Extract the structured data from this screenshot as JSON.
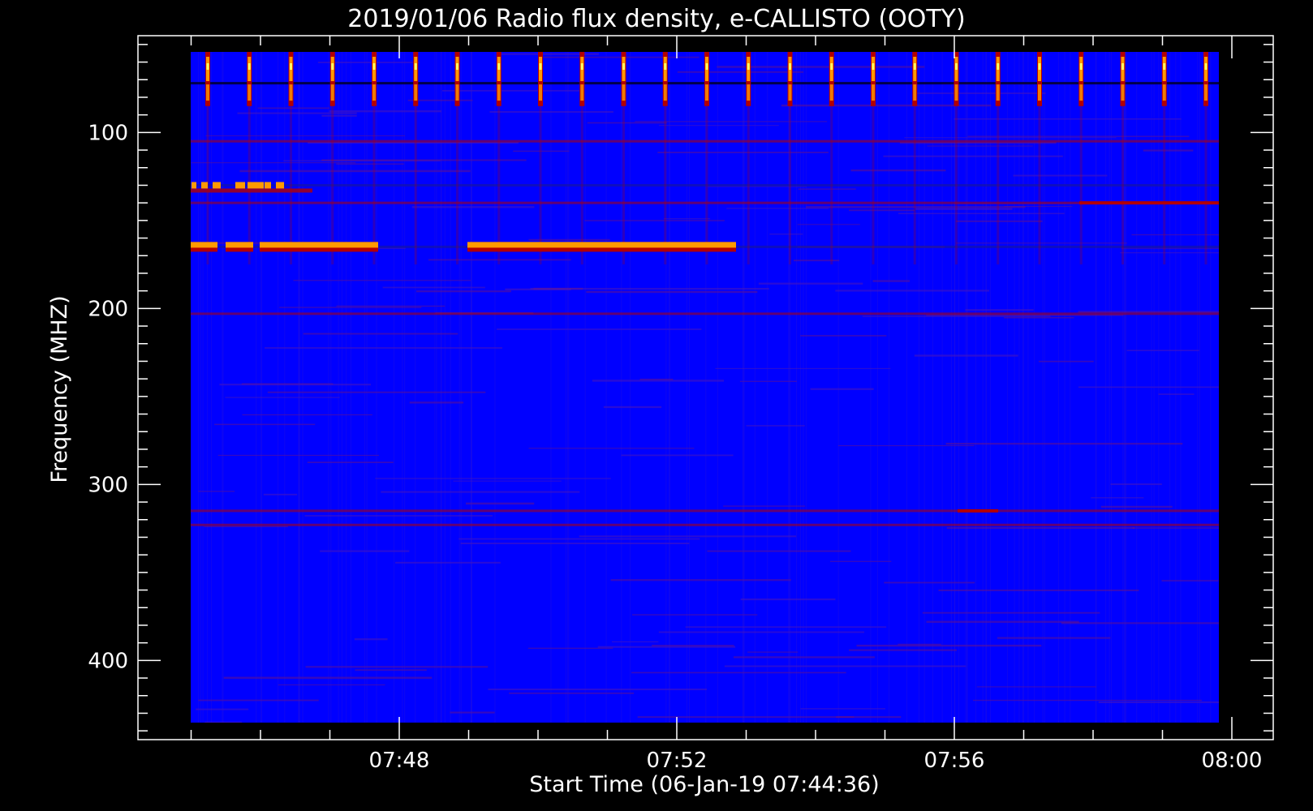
{
  "chart_data": {
    "type": "heatmap",
    "title": "2019/01/06  Radio flux density, e-CALLISTO (OOTY)",
    "xlabel": "Start Time (06-Jan-19 07:44:36)",
    "ylabel": "Frequency (MHZ)",
    "x_tick_labels": [
      "07:48",
      "07:52",
      "07:56",
      "08:00"
    ],
    "y_tick_labels": [
      "100",
      "200",
      "300",
      "400"
    ],
    "y_ticks": [
      100,
      200,
      300,
      400
    ],
    "ylim": [
      445,
      45
    ],
    "y_inverted": true,
    "data_freq_range_mhz": [
      45,
      445
    ],
    "colors": {
      "background": "#0000ff",
      "low": "#1a1a8c",
      "mid": "#b30000",
      "high": "#ff9a00",
      "peak": "#ffff66"
    },
    "periodic_vertical_bursts": {
      "count": 25,
      "freq_range_mhz": [
        45,
        85
      ]
    },
    "horizontal_bands_mhz": [
      {
        "freq": 72,
        "level": "dark"
      },
      {
        "freq": 105,
        "level": "mid"
      },
      {
        "freq": 130,
        "level": "high"
      },
      {
        "freq": 140,
        "level": "mid"
      },
      {
        "freq": 165,
        "level": "high"
      },
      {
        "freq": 203,
        "level": "mid"
      },
      {
        "freq": 315,
        "level": "mid"
      },
      {
        "freq": 323,
        "level": "mid"
      }
    ]
  }
}
